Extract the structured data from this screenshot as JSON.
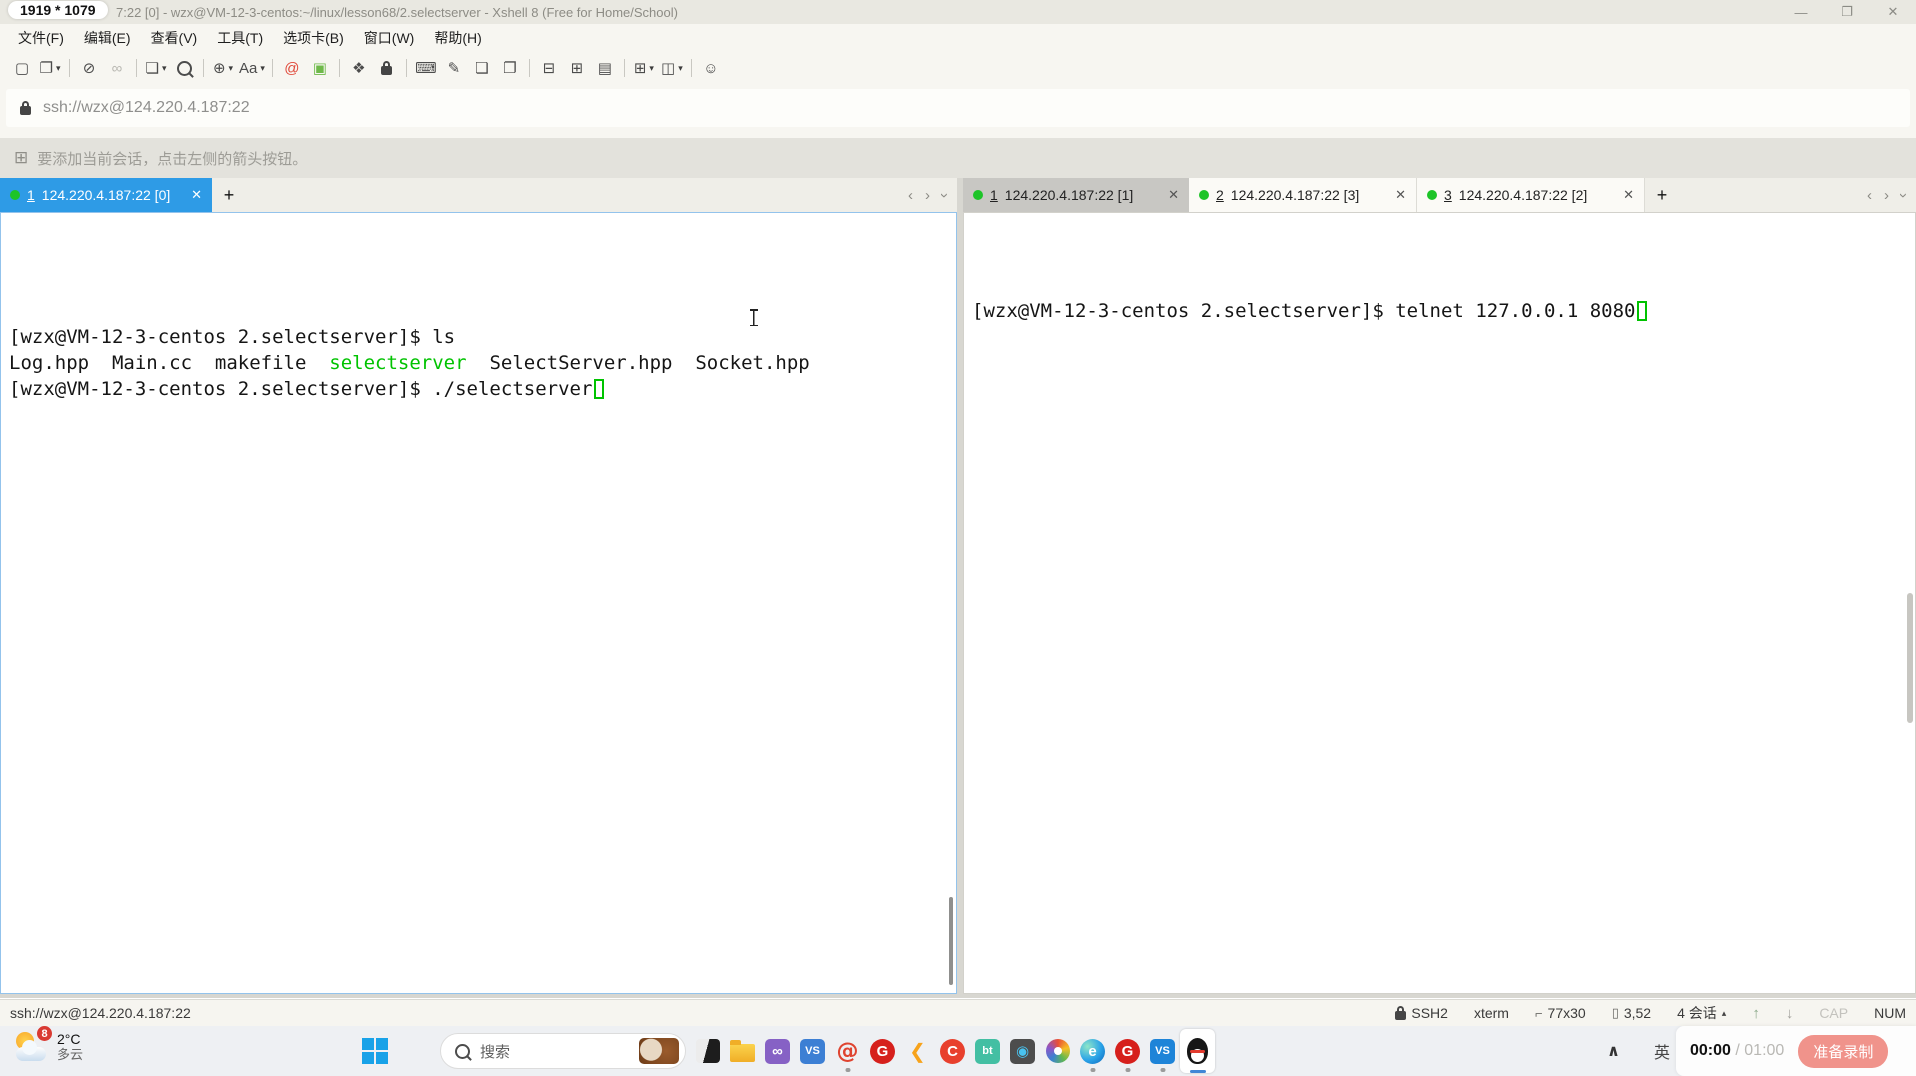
{
  "badge": "1919 * 1079",
  "titlebar": {
    "title": "7:22 [0] - wzx@VM-12-3-centos:~/linux/lesson68/2.selectserver - Xshell 8 (Free for Home/School)",
    "controls": {
      "minimize": "—",
      "restore": "❐",
      "close": "✕"
    }
  },
  "menubar": [
    "文件(F)",
    "编辑(E)",
    "查看(V)",
    "工具(T)",
    "选项卡(B)",
    "窗口(W)",
    "帮助(H)"
  ],
  "toolbar": [
    {
      "name": "new-session-icon",
      "glyph": "▢"
    },
    {
      "name": "open-sessions-icon",
      "glyph": "❐",
      "caret": true
    },
    {
      "sep": true
    },
    {
      "name": "disconnect-icon",
      "glyph": "⊘"
    },
    {
      "name": "reconnect-icon",
      "glyph": "∞",
      "disabled": true
    },
    {
      "sep": true
    },
    {
      "name": "duplicate-session-icon",
      "glyph": "❏",
      "caret": true
    },
    {
      "name": "find-icon",
      "glyph": "mag"
    },
    {
      "sep": true
    },
    {
      "name": "encoding-globe-icon",
      "glyph": "⊕",
      "caret": true
    },
    {
      "name": "font-size-icon",
      "glyph": "Aa",
      "caret": true
    },
    {
      "sep": true
    },
    {
      "name": "xagent-icon",
      "glyph": "@",
      "color": "#e0493a"
    },
    {
      "name": "file-transfer-icon",
      "glyph": "▣",
      "color": "#6fb94a"
    },
    {
      "sep": true
    },
    {
      "name": "fullscreen-icon",
      "glyph": "❖"
    },
    {
      "name": "lock-screen-icon",
      "glyph": "lock"
    },
    {
      "sep": true
    },
    {
      "name": "virtual-keyboard-icon",
      "glyph": "⌨"
    },
    {
      "name": "highlight-icon",
      "glyph": "✎"
    },
    {
      "name": "logging-icon",
      "glyph": "❏"
    },
    {
      "name": "tab-arrange-icon",
      "glyph": "❐"
    },
    {
      "sep": true
    },
    {
      "name": "compose-pane-icon",
      "glyph": "⊟"
    },
    {
      "name": "compose-send-icon",
      "glyph": "⊞"
    },
    {
      "name": "chat-pane-icon",
      "glyph": "▤"
    },
    {
      "sep": true
    },
    {
      "name": "new-window-icon",
      "glyph": "⊞",
      "caret": true
    },
    {
      "name": "tile-layout-icon",
      "glyph": "◫",
      "caret": true
    },
    {
      "sep": true
    },
    {
      "name": "help-icon",
      "glyph": "☺"
    }
  ],
  "addressbar": {
    "url": "ssh://wzx@124.220.4.187:22"
  },
  "infobar": {
    "text": "要添加当前会话，点击左侧的箭头按钮。"
  },
  "ui": {
    "plus": "+",
    "nav_prev": "‹",
    "nav_next": "›",
    "close": "✕",
    "caret_down": "▾"
  },
  "left_pane": {
    "tabs": [
      {
        "num": "1",
        "label": "124.220.4.187:22 [0]",
        "state": "active-focused"
      }
    ],
    "lines": [
      [
        {
          "t": "[wzx@VM-12-3-centos 2.selectserver]$ ls"
        }
      ],
      [
        {
          "t": "Log.hpp  Main.cc  makefile  "
        },
        {
          "t": "selectserver",
          "c": "green"
        },
        {
          "t": "  SelectServer.hpp  Socket.hpp"
        }
      ],
      [
        {
          "t": "[wzx@VM-12-3-centos 2.selectserver]$ ./selectserver"
        },
        {
          "cursor": true
        }
      ]
    ]
  },
  "right_pane": {
    "tabs": [
      {
        "num": "1",
        "label": "124.220.4.187:22 [1]",
        "state": "active-unfocused"
      },
      {
        "num": "2",
        "label": "124.220.4.187:22 [3]",
        "state": "inactive"
      },
      {
        "num": "3",
        "label": "124.220.4.187:22 [2]",
        "state": "inactive"
      }
    ],
    "lines": [
      [
        {
          "t": "[wzx@VM-12-3-centos 2.selectserver]$ telnet 127.0.0.1 8080"
        },
        {
          "cursor": true
        }
      ]
    ]
  },
  "statusbar": {
    "session": "ssh://wzx@124.220.4.187:22",
    "items": [
      {
        "name": "protocol",
        "icon": "lock",
        "label": "SSH2"
      },
      {
        "name": "terminal-type",
        "label": "xterm"
      },
      {
        "name": "terminal-size",
        "icon": "size",
        "label": "77x30"
      },
      {
        "name": "cursor-position",
        "icon": "pos",
        "label": "3,52"
      },
      {
        "name": "session-count",
        "label": "4 会话",
        "tri": "▴"
      },
      {
        "name": "scroll-up",
        "arrow": "up",
        "label": "↑"
      },
      {
        "name": "scroll-down",
        "arrow": "dn",
        "label": "↓"
      },
      {
        "name": "caps-lock",
        "label": "CAP",
        "dim": true
      },
      {
        "name": "num-lock",
        "label": "NUM"
      }
    ]
  },
  "taskbar": {
    "weather": {
      "badge": "8",
      "temp": "2°C",
      "condition": "多云"
    },
    "search": {
      "placeholder": "搜索"
    },
    "apps": [
      {
        "name": "terminal-app-icon",
        "kind": "terminal"
      },
      {
        "name": "file-explorer-icon",
        "kind": "folder"
      },
      {
        "name": "visual-studio-icon",
        "kind": "glyph",
        "bg": "#8661c5",
        "fg": "#ffffff",
        "glyph": "∞"
      },
      {
        "name": "vscode-installer-icon",
        "kind": "glyph",
        "bg": "#3c7fd4",
        "fg": "#ffffff",
        "glyph": "VS"
      },
      {
        "name": "xshell-icon",
        "kind": "snail",
        "glyph": "@",
        "running": true
      },
      {
        "name": "gitee-icon",
        "kind": "glyph",
        "bg": "#d6201c",
        "fg": "#ffffff",
        "glyph": "G",
        "round": true
      },
      {
        "name": "leetcode-icon",
        "kind": "leet",
        "glyph": "❮"
      },
      {
        "name": "csdn-icon",
        "kind": "glyph",
        "bg": "#e8402d",
        "fg": "#ffffff",
        "glyph": "C",
        "round": true
      },
      {
        "name": "baota-icon",
        "kind": "glyph",
        "bg": "#43bfa3",
        "fg": "#ffffff",
        "glyph": "bt"
      },
      {
        "name": "swirl-app-icon",
        "kind": "glyph",
        "bg": "#4d4d4d",
        "fg": "#49c3f0",
        "glyph": "◉"
      },
      {
        "name": "palette-icon",
        "kind": "palette"
      },
      {
        "name": "edge-icon",
        "kind": "edge",
        "glyph": "e",
        "running": true
      },
      {
        "name": "gitee-2-icon",
        "kind": "glyph",
        "bg": "#d6201c",
        "fg": "#ffffff",
        "glyph": "G",
        "round": true,
        "running": true
      },
      {
        "name": "vscode-icon",
        "kind": "glyph",
        "bg": "#1e84d8",
        "fg": "#ffffff",
        "glyph": "VS",
        "running": true
      },
      {
        "name": "qq-icon",
        "kind": "qq",
        "active": true
      }
    ],
    "tray": {
      "expand": "∧",
      "ime": "英"
    },
    "recorder": {
      "elapsed": "00:00",
      "separator": "/",
      "total": "01:00",
      "button": "准备录制"
    }
  },
  "colors": {
    "accent_blue": "#2e9be6",
    "terminal_green": "#00c300",
    "tab_dot_green": "#1dc428",
    "active_unfocused_tab": "#c8c7c3",
    "record_pill": "#f0938b"
  }
}
